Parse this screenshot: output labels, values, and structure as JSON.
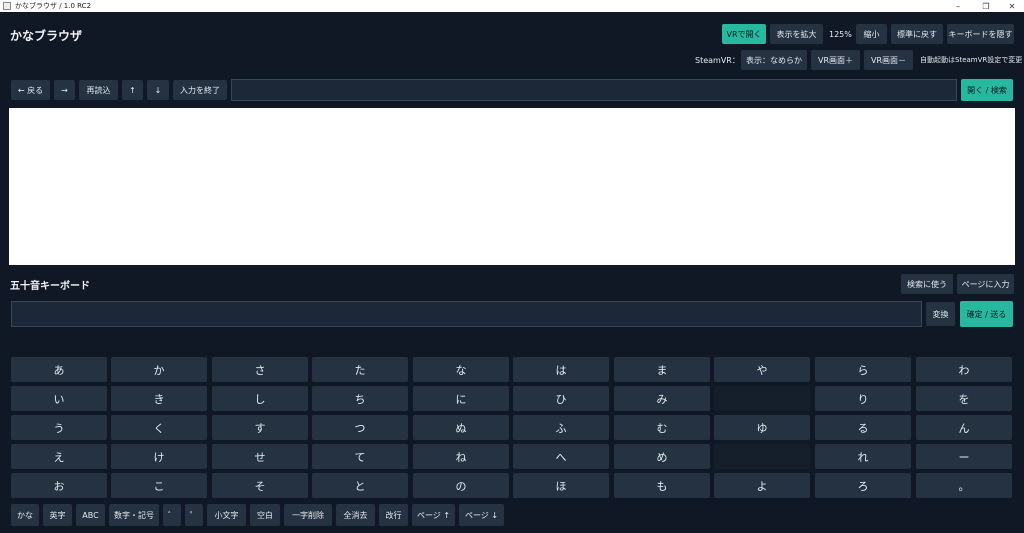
{
  "window": {
    "title": "かなブラウザ / 1.0 RC2",
    "controls": [
      "–",
      "❐",
      "✕"
    ]
  },
  "app": {
    "title": "かなブラウザ"
  },
  "top_controls": {
    "open_vr": "VRで開く",
    "zoom_in": "表示を拡大",
    "zoom_level": "125%",
    "zoom_out": "縮小",
    "zoom_reset": "標準に戻す",
    "hide_keyboard": "キーボードを隠す"
  },
  "steamvr": {
    "label": "SteamVR：",
    "display_mode": "表示：なめらか",
    "vr_screen_plus": "VR画面＋",
    "vr_screen_minus": "VR画面－",
    "autostart_note": "自動起動はSteamVR設定で変更"
  },
  "nav": {
    "back": "← 戻る",
    "forward": "→",
    "reload": "再読込",
    "up": "↑",
    "down": "↓",
    "end_input": "入力を終了",
    "url_value": "",
    "open_search": "開く / 検索"
  },
  "keyboard_section": {
    "title": "五十音キーボード",
    "use_search": "検索に使う",
    "input_page": "ページに入力",
    "composition_value": "",
    "convert": "変換",
    "confirm_send": "確定 / 送る"
  },
  "kana_columns": [
    [
      "あ",
      "い",
      "う",
      "え",
      "お"
    ],
    [
      "か",
      "き",
      "く",
      "け",
      "こ"
    ],
    [
      "さ",
      "し",
      "す",
      "せ",
      "そ"
    ],
    [
      "た",
      "ち",
      "つ",
      "て",
      "と"
    ],
    [
      "な",
      "に",
      "ぬ",
      "ね",
      "の"
    ],
    [
      "は",
      "ひ",
      "ふ",
      "へ",
      "ほ"
    ],
    [
      "ま",
      "み",
      "む",
      "め",
      "も"
    ],
    [
      "や",
      "",
      "ゆ",
      "",
      "よ"
    ],
    [
      "ら",
      "り",
      "る",
      "れ",
      "ろ"
    ],
    [
      "わ",
      "を",
      "ん",
      "ー",
      "。"
    ]
  ],
  "function_keys": [
    "かな",
    "英字",
    "ABC",
    "数字・記号",
    "゛",
    "゜",
    "小文字",
    "空白",
    "一字削除",
    "全消去",
    "改行",
    "ページ ↑",
    "ページ ↓"
  ],
  "colors": {
    "background": "#0f1824",
    "button": "#253242",
    "accent": "#27b8a0"
  }
}
